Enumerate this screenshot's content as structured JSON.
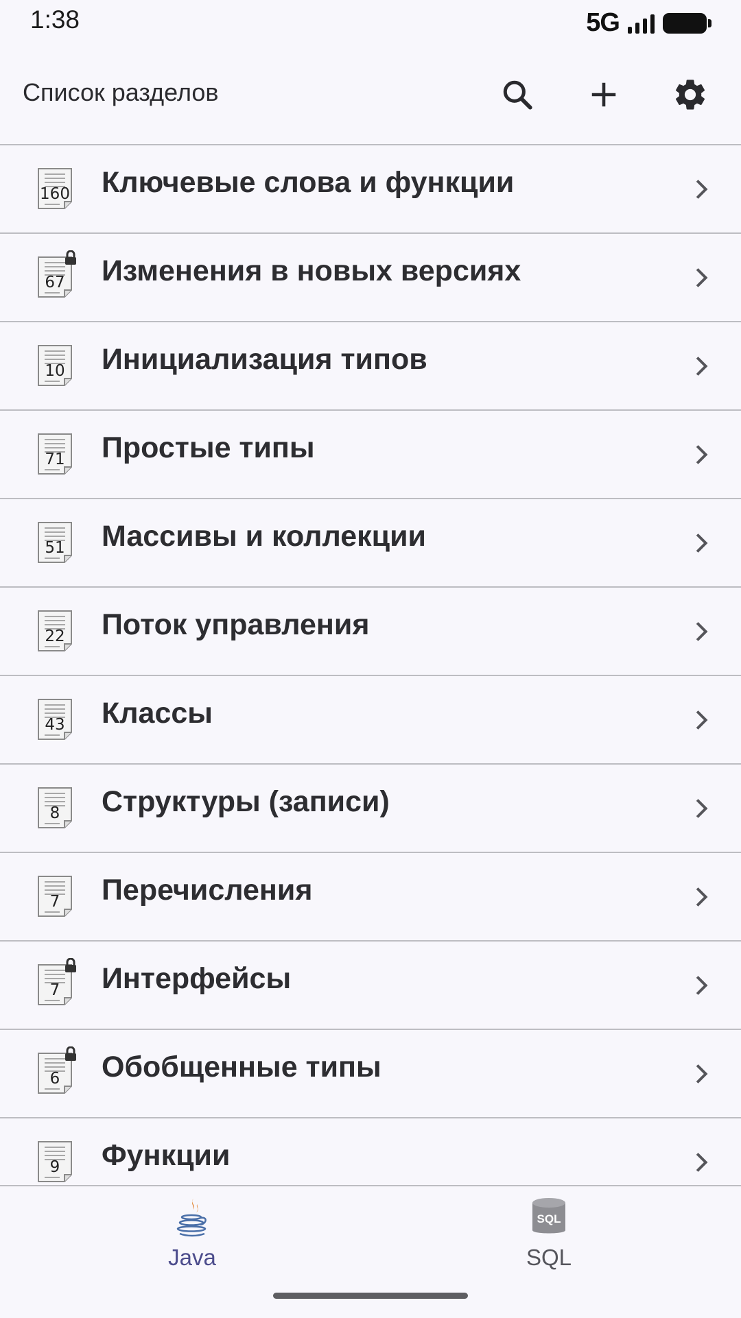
{
  "status": {
    "time": "1:38",
    "network": "5G"
  },
  "app_bar": {
    "title": "Список разделов",
    "icons": {
      "search": "search-icon",
      "add": "plus-icon",
      "settings": "gear-icon"
    }
  },
  "sections": [
    {
      "label": "Ключевые слова и функции",
      "count": "160",
      "locked": false
    },
    {
      "label": "Изменения в новых версиях",
      "count": "67",
      "locked": true
    },
    {
      "label": "Инициализация типов",
      "count": "10",
      "locked": false
    },
    {
      "label": "Простые типы",
      "count": "71",
      "locked": false
    },
    {
      "label": "Массивы и коллекции",
      "count": "51",
      "locked": false
    },
    {
      "label": "Поток управления",
      "count": "22",
      "locked": false
    },
    {
      "label": "Классы",
      "count": "43",
      "locked": false
    },
    {
      "label": "Структуры (записи)",
      "count": "8",
      "locked": false
    },
    {
      "label": "Перечисления",
      "count": "7",
      "locked": false
    },
    {
      "label": "Интерфейсы",
      "count": "7",
      "locked": true
    },
    {
      "label": "Обобщенные типы",
      "count": "6",
      "locked": true
    },
    {
      "label": "Функции",
      "count": "9",
      "locked": false
    }
  ],
  "bottom_nav": {
    "java": {
      "label": "Java",
      "active": true
    },
    "sql": {
      "label": "SQL",
      "active": false,
      "icon_text": "SQL"
    }
  },
  "colors": {
    "background": "#f8f7fc",
    "active_nav": "#4c4c8c",
    "divider": "#bdbdc2"
  }
}
